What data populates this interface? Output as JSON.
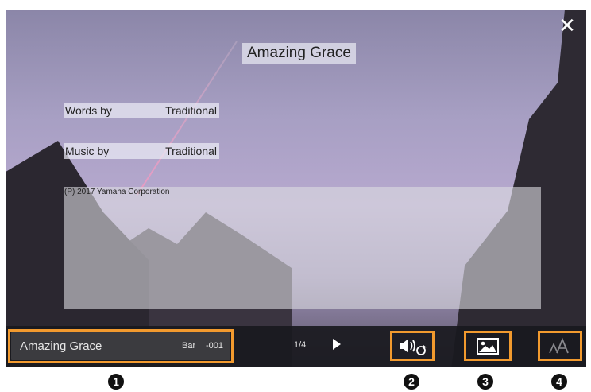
{
  "lyrics": {
    "title": "Amazing Grace",
    "words_label": "Words by",
    "words_value": "Traditional",
    "music_label": "Music by",
    "music_value": "Traditional",
    "copyright": "(P) 2017 Yamaha Corporation"
  },
  "bottom_bar": {
    "song_name": "Amazing Grace",
    "bar_label": "Bar",
    "bar_number": "-001",
    "page_indicator": "1/4"
  },
  "icons": {
    "close": "close-icon",
    "play": "play-icon",
    "audio_repeat": "speaker-repeat-icon",
    "background": "picture-icon",
    "font_size": "font-size-icon"
  },
  "callouts": [
    "1",
    "2",
    "3",
    "4"
  ],
  "colors": {
    "highlight": "#f29a2e",
    "bar_bg": "#19191e"
  }
}
